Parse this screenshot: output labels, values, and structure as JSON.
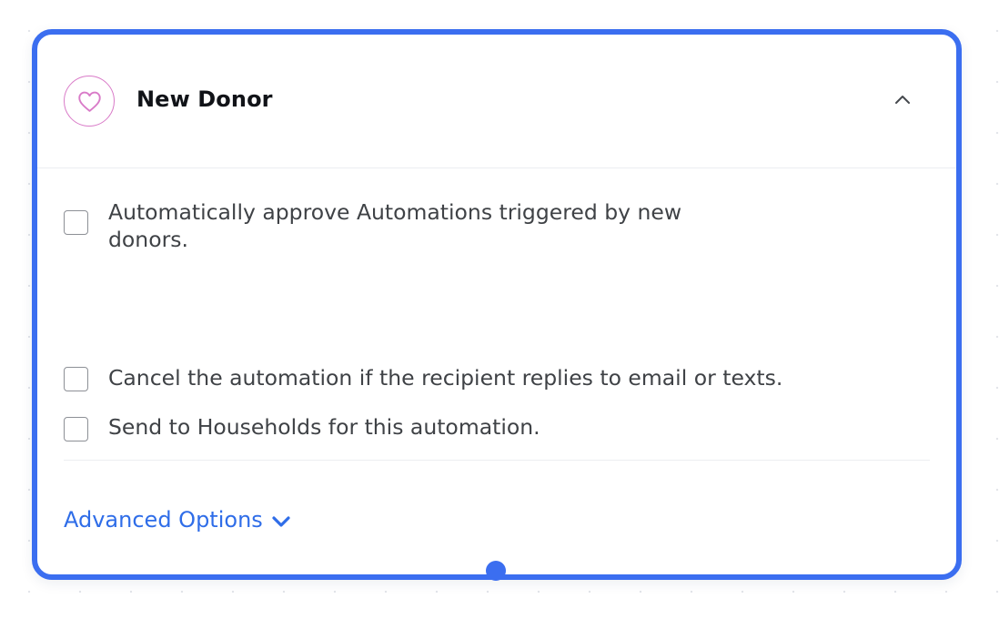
{
  "colors": {
    "accent": "#3b6ef0",
    "link": "#2f6de8",
    "icon_pink": "#d97bc8"
  },
  "card": {
    "icon": "heart-icon",
    "title": "New Donor",
    "collapse_icon": "chevron-up-icon"
  },
  "options": [
    {
      "label": "Automatically approve Automations triggered by new donors.",
      "checked": false
    },
    {
      "label": "Cancel the automation if the recipient replies to email or texts.",
      "checked": false
    },
    {
      "label": "Send to Households for this automation.",
      "checked": false
    }
  ],
  "advanced": {
    "label": "Advanced Options",
    "icon": "chevron-down-icon"
  }
}
